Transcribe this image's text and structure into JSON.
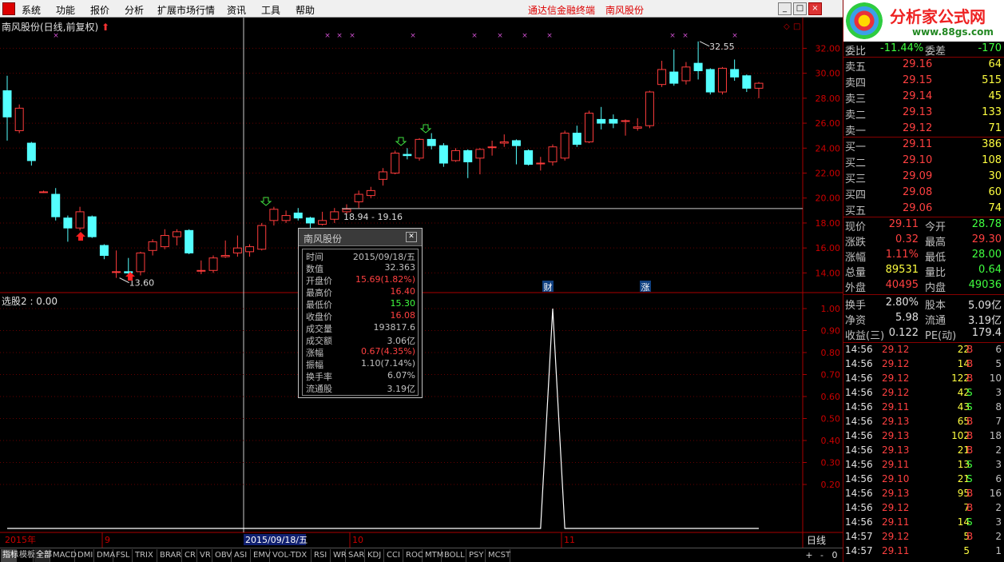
{
  "menu": {
    "items": [
      "系统",
      "功能",
      "报价",
      "分析",
      "扩展市场行情",
      "资讯",
      "工具",
      "帮助"
    ],
    "center_title": "通达信金融终端",
    "stock_name": "南风股份"
  },
  "window_buttons": [
    "_",
    "□",
    "×"
  ],
  "chart": {
    "title": "南风股份(日线,前复权)",
    "lower_title": "选股2 : 0.00",
    "price_axis": [
      "32.00",
      "30.00",
      "28.00",
      "26.00",
      "24.00",
      "22.00",
      "20.00",
      "18.00",
      "16.00",
      "14.00"
    ],
    "lower_axis": [
      "1.00",
      "0.90",
      "0.80",
      "0.70",
      "0.60",
      "0.50",
      "0.40",
      "0.30",
      "0.20"
    ],
    "annotations": {
      "high": "32.55",
      "low": "13.60",
      "range": "18.94 - 19.16",
      "cai": "财",
      "zhang": "涨"
    },
    "date_axis": {
      "year": "2015年",
      "m9": "9",
      "cursor_date": "2015/09/18/五",
      "m10": "10",
      "m11": "11"
    },
    "period": "日线",
    "marker_x_labels": [
      "×",
      "×",
      "×",
      "×",
      "×",
      "×",
      "×",
      "×",
      "×",
      "×",
      "×",
      "×"
    ]
  },
  "chart_data": {
    "type": "candlestick",
    "title": "南风股份(日线,前复权)",
    "ylim": [
      13.0,
      33.5
    ],
    "candles": [
      {
        "o": 28.6,
        "c": 26.5,
        "h": 29.8,
        "l": 24.6
      },
      {
        "o": 25.4,
        "c": 27.2,
        "h": 27.5,
        "l": 25.2
      },
      {
        "o": 24.4,
        "c": 23.0,
        "h": 24.5,
        "l": 22.6
      },
      {
        "o": 20.5,
        "c": 20.5,
        "h": 20.6,
        "l": 20.4
      },
      {
        "o": 20.3,
        "c": 18.5,
        "h": 20.8,
        "l": 18.2
      },
      {
        "o": 18.4,
        "c": 17.6,
        "h": 18.6,
        "l": 16.5
      },
      {
        "o": 17.6,
        "c": 18.9,
        "h": 19.3,
        "l": 17.4
      },
      {
        "o": 18.5,
        "c": 16.9,
        "h": 18.6,
        "l": 16.8
      },
      {
        "o": 16.2,
        "c": 15.4,
        "h": 16.3,
        "l": 15.1
      },
      {
        "o": 14.1,
        "c": 14.1,
        "h": 15.8,
        "l": 13.6
      },
      {
        "o": 14.1,
        "c": 14.0,
        "h": 15.2,
        "l": 13.6
      },
      {
        "o": 14.1,
        "c": 15.6,
        "h": 15.7,
        "l": 13.8
      },
      {
        "o": 15.8,
        "c": 16.5,
        "h": 16.7,
        "l": 15.4
      },
      {
        "o": 16.1,
        "c": 17.0,
        "h": 17.5,
        "l": 15.9
      },
      {
        "o": 16.9,
        "c": 17.3,
        "h": 17.5,
        "l": 16.2
      },
      {
        "o": 17.4,
        "c": 15.6,
        "h": 17.5,
        "l": 15.5
      },
      {
        "o": 14.2,
        "c": 14.2,
        "h": 15.0,
        "l": 13.9
      },
      {
        "o": 14.2,
        "c": 15.2,
        "h": 15.4,
        "l": 14.0
      },
      {
        "o": 15.3,
        "c": 15.4,
        "h": 16.6,
        "l": 15.2
      },
      {
        "o": 15.6,
        "c": 16.0,
        "h": 17.0,
        "l": 15.3
      },
      {
        "o": 15.7,
        "c": 16.1,
        "h": 16.3,
        "l": 15.3
      },
      {
        "o": 15.9,
        "c": 17.8,
        "h": 18.0,
        "l": 15.8
      },
      {
        "o": 18.2,
        "c": 19.1,
        "h": 19.3,
        "l": 17.8
      },
      {
        "o": 18.2,
        "c": 18.6,
        "h": 19.0,
        "l": 18.0
      },
      {
        "o": 18.8,
        "c": 18.4,
        "h": 19.2,
        "l": 18.2
      },
      {
        "o": 18.4,
        "c": 18.0,
        "h": 18.5,
        "l": 17.6
      },
      {
        "o": 17.9,
        "c": 18.2,
        "h": 18.9,
        "l": 17.8
      },
      {
        "o": 18.3,
        "c": 18.9,
        "h": 19.2,
        "l": 18.0
      },
      {
        "o": 18.9,
        "c": 19.1,
        "h": 19.5,
        "l": 18.7
      },
      {
        "o": 19.7,
        "c": 20.3,
        "h": 20.6,
        "l": 19.2
      },
      {
        "o": 20.2,
        "c": 20.6,
        "h": 20.9,
        "l": 20.0
      },
      {
        "o": 21.5,
        "c": 22.1,
        "h": 22.4,
        "l": 21.0
      },
      {
        "o": 22.0,
        "c": 23.6,
        "h": 23.8,
        "l": 21.9
      },
      {
        "o": 23.5,
        "c": 23.4,
        "h": 24.0,
        "l": 23.1
      },
      {
        "o": 23.2,
        "c": 24.7,
        "h": 24.8,
        "l": 23.0
      },
      {
        "o": 24.7,
        "c": 24.2,
        "h": 25.2,
        "l": 23.9
      },
      {
        "o": 24.2,
        "c": 22.8,
        "h": 24.4,
        "l": 22.5
      },
      {
        "o": 23.0,
        "c": 23.8,
        "h": 24.0,
        "l": 22.9
      },
      {
        "o": 23.8,
        "c": 22.9,
        "h": 23.9,
        "l": 21.6
      },
      {
        "o": 23.2,
        "c": 23.9,
        "h": 24.0,
        "l": 21.9
      },
      {
        "o": 24.1,
        "c": 24.1,
        "h": 24.6,
        "l": 23.4
      },
      {
        "o": 24.4,
        "c": 24.5,
        "h": 25.1,
        "l": 24.1
      },
      {
        "o": 24.6,
        "c": 24.2,
        "h": 24.7,
        "l": 22.7
      },
      {
        "o": 23.8,
        "c": 22.7,
        "h": 23.9,
        "l": 22.6
      },
      {
        "o": 22.8,
        "c": 22.8,
        "h": 23.3,
        "l": 22.2
      },
      {
        "o": 22.9,
        "c": 24.1,
        "h": 24.3,
        "l": 22.6
      },
      {
        "o": 23.2,
        "c": 25.2,
        "h": 25.4,
        "l": 23.0
      },
      {
        "o": 25.2,
        "c": 24.3,
        "h": 25.8,
        "l": 24.1
      },
      {
        "o": 24.5,
        "c": 26.8,
        "h": 27.0,
        "l": 24.4
      },
      {
        "o": 26.3,
        "c": 26.0,
        "h": 27.3,
        "l": 25.5
      },
      {
        "o": 26.3,
        "c": 26.0,
        "h": 26.7,
        "l": 25.6
      },
      {
        "o": 26.2,
        "c": 26.2,
        "h": 26.3,
        "l": 25.0
      },
      {
        "o": 25.6,
        "c": 25.7,
        "h": 26.4,
        "l": 25.4
      },
      {
        "o": 25.8,
        "c": 28.5,
        "h": 28.6,
        "l": 25.6
      },
      {
        "o": 29.1,
        "c": 30.3,
        "h": 31.0,
        "l": 28.9
      },
      {
        "o": 30.1,
        "c": 29.2,
        "h": 31.9,
        "l": 29.0
      },
      {
        "o": 29.4,
        "c": 30.5,
        "h": 30.9,
        "l": 29.1
      },
      {
        "o": 30.8,
        "c": 30.2,
        "h": 32.55,
        "l": 29.5
      },
      {
        "o": 30.3,
        "c": 28.5,
        "h": 30.4,
        "l": 28.3
      },
      {
        "o": 28.5,
        "c": 30.4,
        "h": 30.5,
        "l": 28.3
      },
      {
        "o": 30.3,
        "c": 29.7,
        "h": 31.1,
        "l": 29.4
      },
      {
        "o": 29.8,
        "c": 28.8,
        "h": 29.9,
        "l": 28.5
      },
      {
        "o": 28.8,
        "c": 29.2,
        "h": 29.3,
        "l": 28.0
      }
    ],
    "indicator": {
      "name": "选股2",
      "values_peak_index": 45,
      "peak": 1.0
    }
  },
  "popup": {
    "title": "南风股份",
    "rows": [
      {
        "label": "时间",
        "value": "2015/09/18/五",
        "color": "#c0c0c0"
      },
      {
        "label": "数值",
        "value": "32.363",
        "color": "#c0c0c0"
      },
      {
        "label": "开盘价",
        "value": "15.69(1.82%)",
        "color": "#ff4040"
      },
      {
        "label": "最高价",
        "value": "16.40",
        "color": "#ff4040"
      },
      {
        "label": "最低价",
        "value": "15.30",
        "color": "#40ff40"
      },
      {
        "label": "收盘价",
        "value": "16.08",
        "color": "#ff4040"
      },
      {
        "label": "成交量",
        "value": "193817.6",
        "color": "#c0c0c0"
      },
      {
        "label": "成交额",
        "value": "3.06亿",
        "color": "#c0c0c0"
      },
      {
        "label": "涨幅",
        "value": "0.67(4.35%)",
        "color": "#ff4040"
      },
      {
        "label": "振幅",
        "value": "1.10(7.14%)",
        "color": "#c0c0c0"
      },
      {
        "label": "换手率",
        "value": "6.07%",
        "color": "#c0c0c0"
      },
      {
        "label": "流通股",
        "value": "3.19亿",
        "color": "#c0c0c0"
      }
    ]
  },
  "logo": {
    "title": "分析家公式网",
    "url": "www.88gs.com"
  },
  "quote": {
    "weibi": {
      "label": "委比",
      "value": "-11.44%",
      "label2": "委差",
      "value2": "-170"
    },
    "sell": [
      {
        "label": "卖五",
        "price": "29.16",
        "vol": "64"
      },
      {
        "label": "卖四",
        "price": "29.15",
        "vol": "515"
      },
      {
        "label": "卖三",
        "price": "29.14",
        "vol": "45"
      },
      {
        "label": "卖二",
        "price": "29.13",
        "vol": "133"
      },
      {
        "label": "卖一",
        "price": "29.12",
        "vol": "71"
      }
    ],
    "buy": [
      {
        "label": "买一",
        "price": "29.11",
        "vol": "386"
      },
      {
        "label": "买二",
        "price": "29.10",
        "vol": "108"
      },
      {
        "label": "买三",
        "price": "29.09",
        "vol": "30"
      },
      {
        "label": "买四",
        "price": "29.08",
        "vol": "60"
      },
      {
        "label": "买五",
        "price": "29.06",
        "vol": "74"
      }
    ],
    "stats": [
      {
        "l1": "现价",
        "v1": "29.11",
        "c1": "#ff4040",
        "l2": "今开",
        "v2": "28.78",
        "c2": "#40ff40"
      },
      {
        "l1": "涨跌",
        "v1": "0.32",
        "c1": "#ff4040",
        "l2": "最高",
        "v2": "29.30",
        "c2": "#ff4040"
      },
      {
        "l1": "涨幅",
        "v1": "1.11%",
        "c1": "#ff4040",
        "l2": "最低",
        "v2": "28.00",
        "c2": "#40ff40"
      },
      {
        "l1": "总量",
        "v1": "89531",
        "c1": "#ffff40",
        "l2": "量比",
        "v2": "0.64",
        "c2": "#40ff40"
      },
      {
        "l1": "外盘",
        "v1": "40495",
        "c1": "#ff4040",
        "l2": "内盘",
        "v2": "49036",
        "c2": "#40ff40"
      }
    ],
    "stats2": [
      {
        "l1": "换手",
        "v1": "2.80%",
        "l2": "股本",
        "v2": "5.09亿"
      },
      {
        "l1": "净资",
        "v1": "5.98",
        "l2": "流通",
        "v2": "3.19亿"
      },
      {
        "l1": "收益(三)",
        "v1": "0.122",
        "l2": "PE(动)",
        "v2": "179.4"
      }
    ],
    "ticks": [
      {
        "t": "14:56",
        "p": "29.12",
        "v": "22",
        "bs": "B",
        "n": "6"
      },
      {
        "t": "14:56",
        "p": "29.12",
        "v": "14",
        "bs": "B",
        "n": "5"
      },
      {
        "t": "14:56",
        "p": "29.12",
        "v": "122",
        "bs": "B",
        "n": "10"
      },
      {
        "t": "14:56",
        "p": "29.12",
        "v": "42",
        "bs": "S",
        "n": "3"
      },
      {
        "t": "14:56",
        "p": "29.11",
        "v": "43",
        "bs": "S",
        "n": "8"
      },
      {
        "t": "14:56",
        "p": "29.13",
        "v": "65",
        "bs": "B",
        "n": "7"
      },
      {
        "t": "14:56",
        "p": "29.13",
        "v": "102",
        "bs": "B",
        "n": "18"
      },
      {
        "t": "14:56",
        "p": "29.13",
        "v": "21",
        "bs": "B",
        "n": "2"
      },
      {
        "t": "14:56",
        "p": "29.11",
        "v": "13",
        "bs": "S",
        "n": "3"
      },
      {
        "t": "14:56",
        "p": "29.10",
        "v": "21",
        "bs": "S",
        "n": "6"
      },
      {
        "t": "14:56",
        "p": "29.13",
        "v": "95",
        "bs": "B",
        "n": "16"
      },
      {
        "t": "14:56",
        "p": "29.12",
        "v": "7",
        "bs": "B",
        "n": "2"
      },
      {
        "t": "14:56",
        "p": "29.11",
        "v": "14",
        "bs": "S",
        "n": "3"
      },
      {
        "t": "14:57",
        "p": "29.12",
        "v": "5",
        "bs": "B",
        "n": "2"
      },
      {
        "t": "14:57",
        "p": "29.11",
        "v": "5",
        "bs": "",
        "n": "1"
      }
    ]
  },
  "tabs": [
    "指标",
    "模板",
    "全部",
    "MACD",
    "DMI",
    "DMA",
    "FSL",
    "TRIX",
    "BRAR",
    "CR",
    "VR",
    "OBV",
    "ASI",
    "EMV",
    "VOL-TDX",
    "RSI",
    "WR",
    "SAR",
    "KDJ",
    "CCI",
    "ROC",
    "MTM",
    "BOLL",
    "PSY",
    "MCST"
  ],
  "zoom_buttons": [
    "+",
    "-",
    "0"
  ]
}
